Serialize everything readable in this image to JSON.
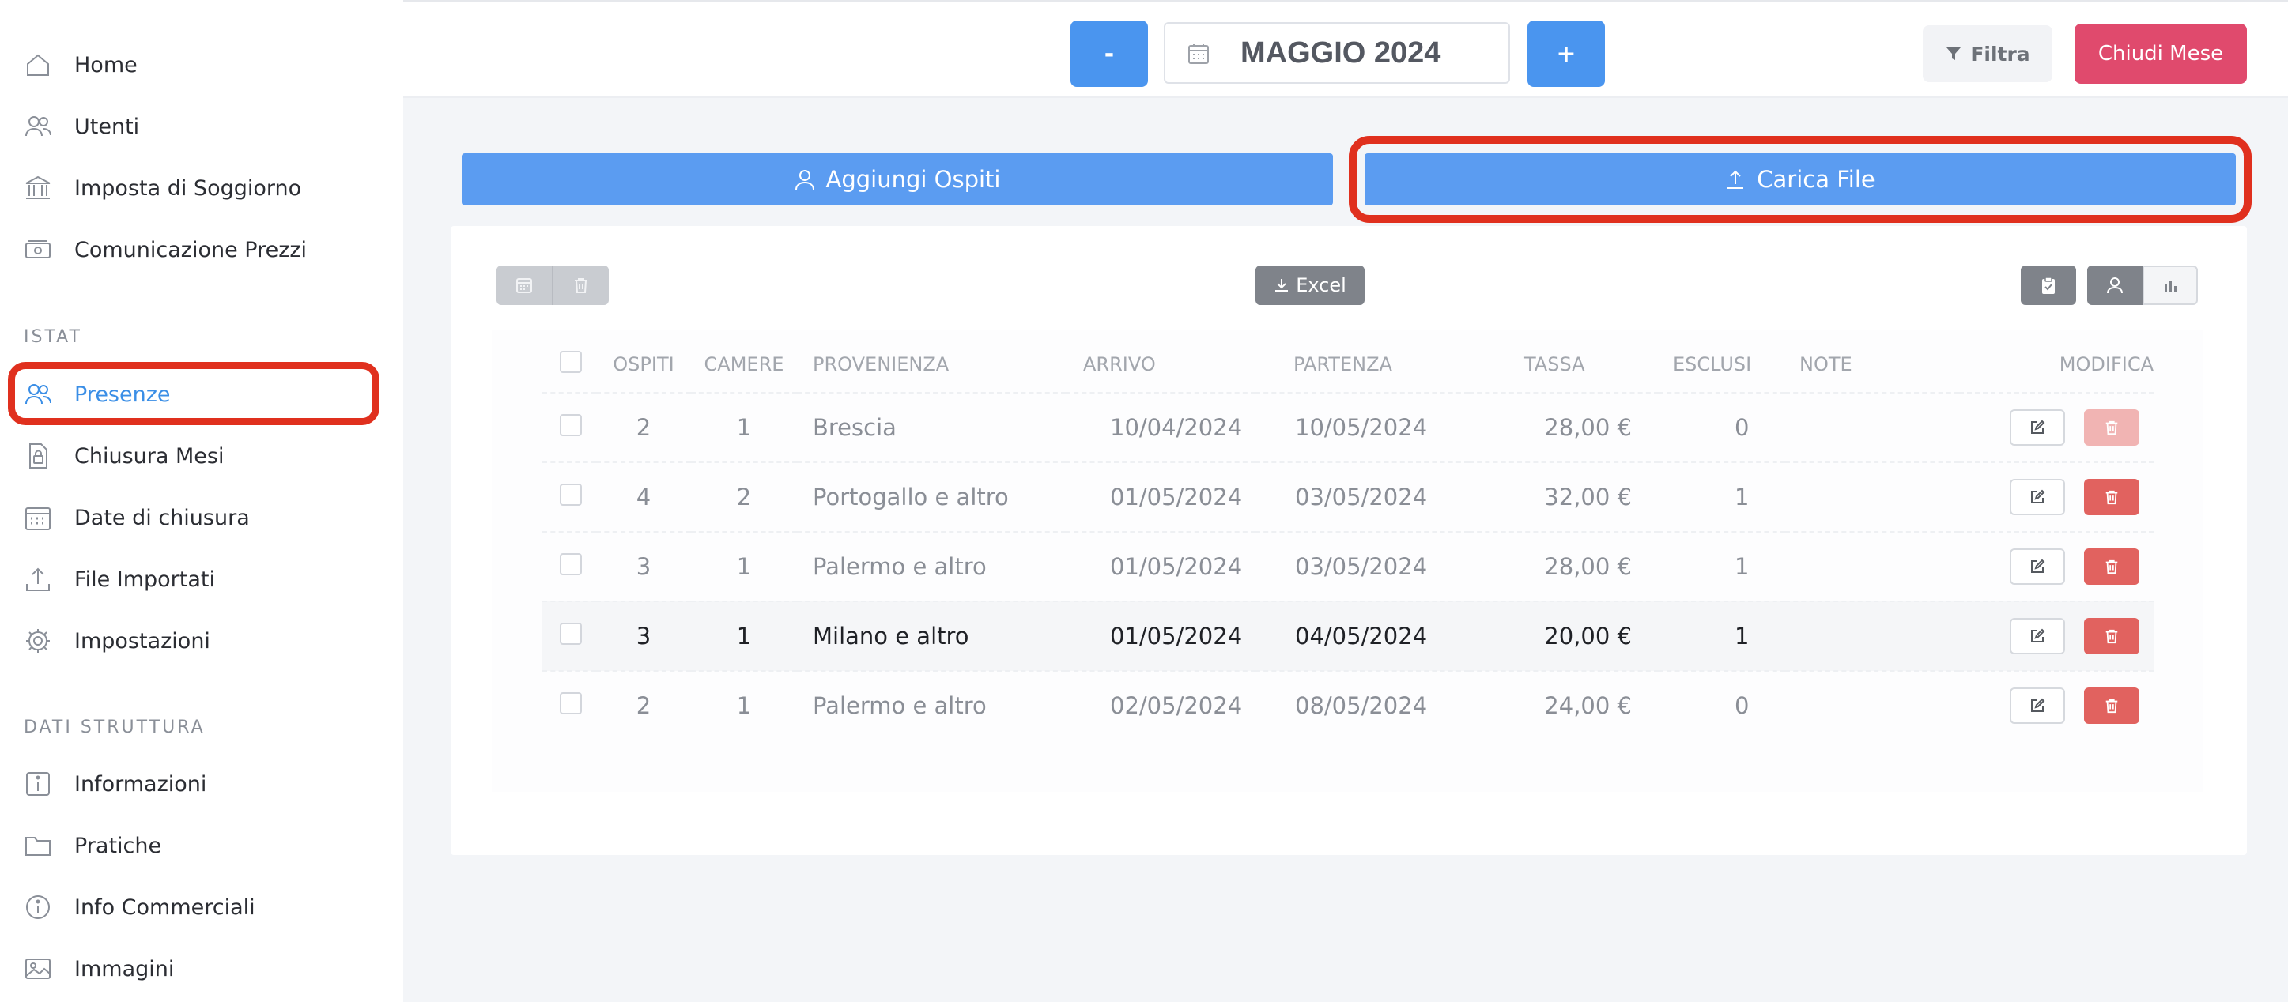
{
  "sidebar": {
    "items": [
      {
        "label": "Home",
        "icon": "home-icon"
      },
      {
        "label": "Utenti",
        "icon": "users-icon"
      },
      {
        "label": "Imposta di Soggiorno",
        "icon": "bank-icon"
      },
      {
        "label": "Comunicazione Prezzi",
        "icon": "money-icon"
      }
    ],
    "section_istat": "ISTAT",
    "istat_items": [
      {
        "label": "Presenze",
        "icon": "users-icon",
        "active": true
      },
      {
        "label": "Chiusura Mesi",
        "icon": "lock-file-icon"
      },
      {
        "label": "Date di chiusura",
        "icon": "calendar-icon"
      },
      {
        "label": "File Importati",
        "icon": "upload-icon"
      },
      {
        "label": "Impostazioni",
        "icon": "gear-icon"
      }
    ],
    "section_dati": "DATI STRUTTURA",
    "dati_items": [
      {
        "label": "Informazioni",
        "icon": "info-square-icon"
      },
      {
        "label": "Pratiche",
        "icon": "folder-icon"
      },
      {
        "label": "Info Commerciali",
        "icon": "info-circle-icon"
      },
      {
        "label": "Immagini",
        "icon": "image-icon"
      }
    ]
  },
  "topbar": {
    "minus_label": "-",
    "month": "MAGGIO 2024",
    "plus_label": "+",
    "filter_label": "Filtra",
    "close_month_label": "Chiudi Mese"
  },
  "actions": {
    "add_guests_label": "Aggiungi Ospiti",
    "upload_file_label": "Carica File",
    "excel_label": "Excel"
  },
  "table": {
    "columns": [
      "OSPITI",
      "CAMERE",
      "PROVENIENZA",
      "ARRIVO",
      "PARTENZA",
      "TASSA",
      "ESCLUSI",
      "NOTE",
      "MODIFICA"
    ],
    "rows": [
      {
        "ospiti": "2",
        "camere": "1",
        "provenienza": "Brescia",
        "arrivo": "10/04/2024",
        "partenza": "10/05/2024",
        "tassa": "28,00 €",
        "esclusi": "0",
        "note": ""
      },
      {
        "ospiti": "4",
        "camere": "2",
        "provenienza": "Portogallo e altro",
        "arrivo": "01/05/2024",
        "partenza": "03/05/2024",
        "tassa": "32,00 €",
        "esclusi": "1",
        "note": ""
      },
      {
        "ospiti": "3",
        "camere": "1",
        "provenienza": "Palermo e altro",
        "arrivo": "01/05/2024",
        "partenza": "03/05/2024",
        "tassa": "28,00 €",
        "esclusi": "1",
        "note": ""
      },
      {
        "ospiti": "3",
        "camere": "1",
        "provenienza": "Milano e altro",
        "arrivo": "01/05/2024",
        "partenza": "04/05/2024",
        "tassa": "20,00 €",
        "esclusi": "1",
        "note": ""
      },
      {
        "ospiti": "2",
        "camere": "1",
        "provenienza": "Palermo e altro",
        "arrivo": "02/05/2024",
        "partenza": "08/05/2024",
        "tassa": "24,00 €",
        "esclusi": "0",
        "note": ""
      }
    ]
  },
  "colors": {
    "primary": "#4a95ef",
    "danger": "#e04a6d",
    "highlight": "#e0301e",
    "active_link": "#3a8ee6"
  }
}
